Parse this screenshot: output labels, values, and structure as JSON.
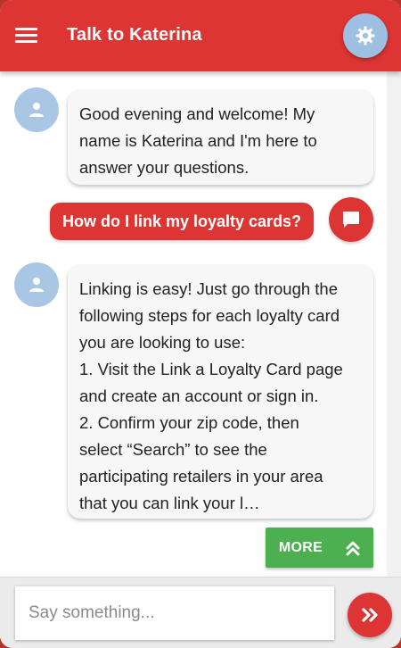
{
  "header": {
    "title": "Talk to Katerina",
    "menu_icon": "hamburger-menu-icon",
    "settings_icon": "gear-icon"
  },
  "messages": [
    {
      "sender": "bot",
      "lines": [
        "Good evening and welcome! My",
        "name is Katerina and I'm here to",
        "answer your questions."
      ]
    },
    {
      "sender": "user",
      "text": "How do I link my loyalty cards?"
    },
    {
      "sender": "bot",
      "lines": [
        "Linking is easy! Just go through the",
        "following steps for each loyalty card",
        "you are looking to use:",
        "1. Visit the Link a Loyalty Card page",
        "and create an account or sign in.",
        "2. Confirm your zip code, then",
        "select “Search” to see the",
        "participating retailers in your area",
        "that you can link your l…"
      ]
    }
  ],
  "more_button": {
    "label": "MORE",
    "icon": "double-chevron-up-icon"
  },
  "composer": {
    "placeholder": "Say something...",
    "send_icon": "double-chevron-right-icon"
  },
  "colors": {
    "brand_red": "#dc3533",
    "avatar_blue": "#a9c6e4",
    "more_green": "#4caf50",
    "bubble_bg": "#f7f7f7"
  }
}
